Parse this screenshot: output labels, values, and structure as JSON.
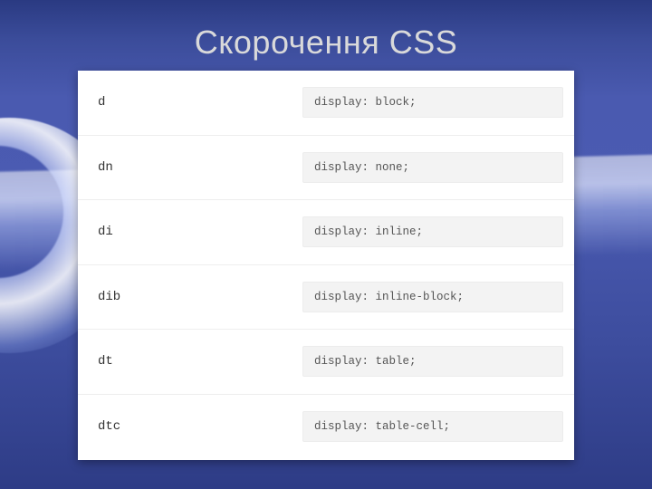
{
  "title": "Скорочення CSS",
  "rows": [
    {
      "abbr": "d",
      "expansion": "display: block;"
    },
    {
      "abbr": "dn",
      "expansion": "display: none;"
    },
    {
      "abbr": "di",
      "expansion": "display: inline;"
    },
    {
      "abbr": "dib",
      "expansion": "display: inline-block;"
    },
    {
      "abbr": "dt",
      "expansion": "display: table;"
    },
    {
      "abbr": "dtc",
      "expansion": "display: table-cell;"
    }
  ]
}
